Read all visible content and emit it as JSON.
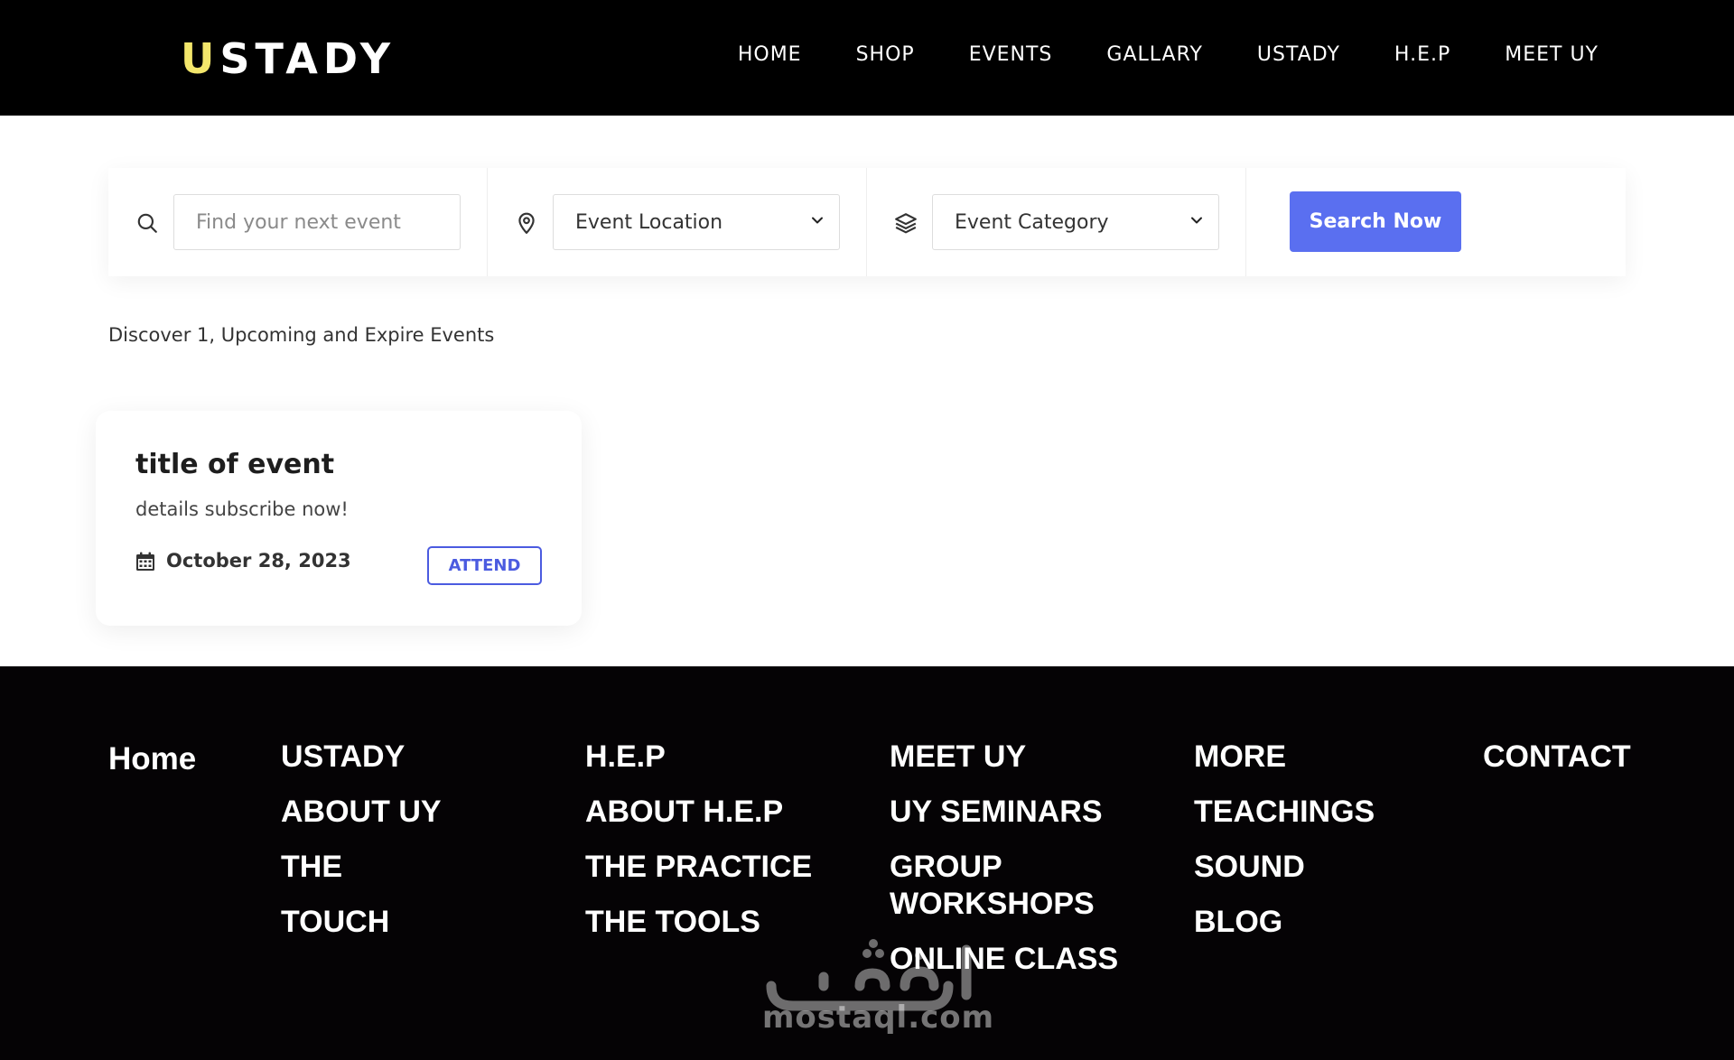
{
  "header": {
    "logo": "USTADY",
    "nav": [
      "HOME",
      "SHOP",
      "EVENTS",
      "GALLARY",
      "USTADY",
      "H.E.P",
      "MEET UY"
    ]
  },
  "search": {
    "keyword_placeholder": "Find your next event",
    "location_value": "Event Location",
    "category_value": "Event Category",
    "button_label": "Search Now",
    "icons": {
      "keyword": "search-icon",
      "location": "map-pin-icon",
      "category": "layers-icon",
      "dropdown": "chevron-down-icon"
    }
  },
  "results": {
    "summary": "Discover 1, Upcoming and Expire Events"
  },
  "event_card": {
    "title": "title of event",
    "details": "details subscribe now!",
    "date": "October 28, 2023",
    "attend_label": "ATTEND",
    "date_icon": "calendar-icon"
  },
  "footer": {
    "home": "Home",
    "col_ustady": [
      "USTADY",
      "ABOUT UY",
      "THE",
      "TOUCH"
    ],
    "col_hep": [
      "H.E.P",
      "ABOUT H.E.P",
      "THE PRACTICE",
      "THE TOOLS"
    ],
    "col_meetuy": [
      "MEET UY",
      "UY SEMINARS",
      "GROUP WORKSHOPS",
      "ONLINE CLASS"
    ],
    "col_more": [
      "MORE",
      "TEACHINGS",
      "SOUND",
      "BLOG"
    ],
    "contact": "CONTACT"
  },
  "watermark": {
    "text": "mostaql.com"
  },
  "colors": {
    "header_bg": "#000000",
    "logo_highlight": "#f3e66b",
    "accent": "#5a6ff0",
    "attend_border": "#4b5be0",
    "footer_bg": "#050305"
  }
}
